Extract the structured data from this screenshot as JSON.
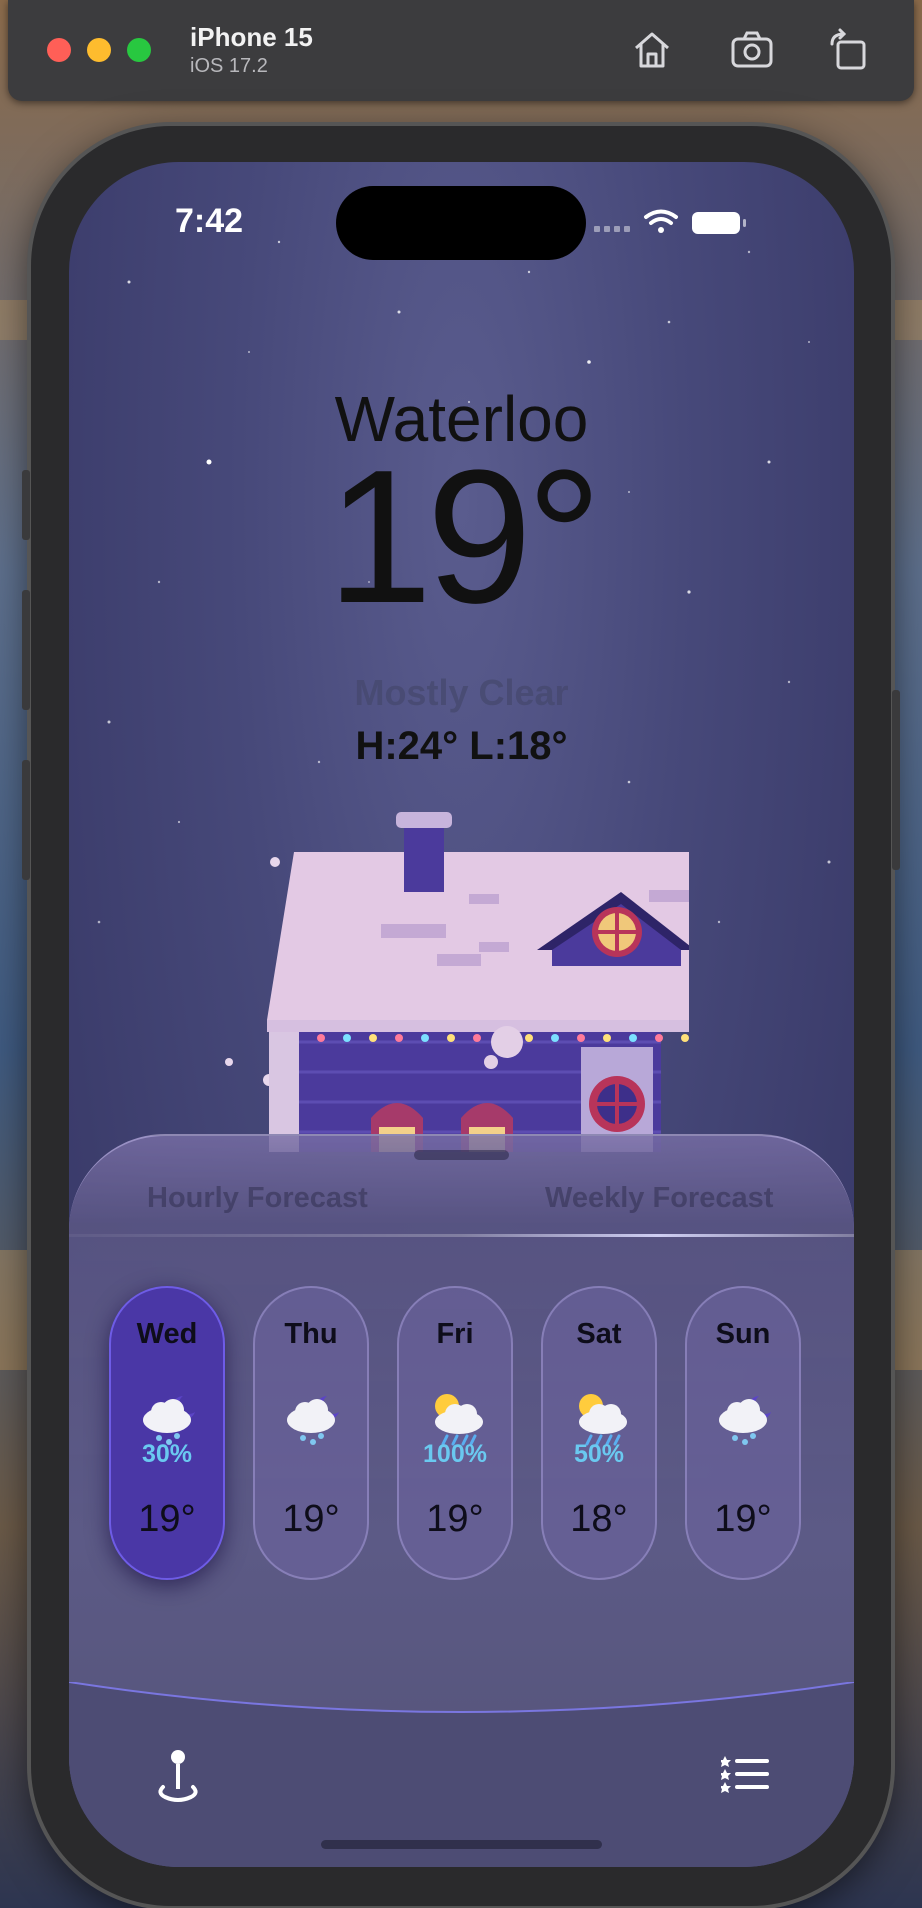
{
  "simulator": {
    "device_name": "iPhone 15",
    "os_version": "iOS 17.2",
    "buttons": {
      "home": "home-icon",
      "screenshot": "camera-icon",
      "rotate": "rotate-icon"
    }
  },
  "status_bar": {
    "time": "7:42"
  },
  "weather": {
    "city": "Waterloo",
    "temperature": "19°",
    "condition": "Mostly Clear",
    "high_low": "H:24°   L:18°"
  },
  "sheet": {
    "tabs": [
      {
        "label": "Hourly Forecast",
        "selected": false
      },
      {
        "label": "Weekly Forecast",
        "selected": true
      }
    ],
    "days": [
      {
        "name": "Wed",
        "icon": "cloud-moon-snow-icon",
        "precip": "30%",
        "temp": "19°",
        "active": true
      },
      {
        "name": "Thu",
        "icon": "cloud-moon-snow-icon",
        "precip": "",
        "temp": "19°",
        "active": false
      },
      {
        "name": "Fri",
        "icon": "cloud-sun-rain-icon",
        "precip": "100%",
        "temp": "19°",
        "active": false
      },
      {
        "name": "Sat",
        "icon": "cloud-sun-rain-icon",
        "precip": "50%",
        "temp": "18°",
        "active": false
      },
      {
        "name": "Sun",
        "icon": "cloud-moon-snow-icon",
        "precip": "",
        "temp": "19°",
        "active": false
      }
    ]
  },
  "tab_bar": {
    "left_icon": "map-pin-icon",
    "right_icon": "list-icon"
  },
  "colors": {
    "active_card": "#4a37a6",
    "precip_text": "#6ac9f0",
    "sheet": "#5c5a86"
  }
}
